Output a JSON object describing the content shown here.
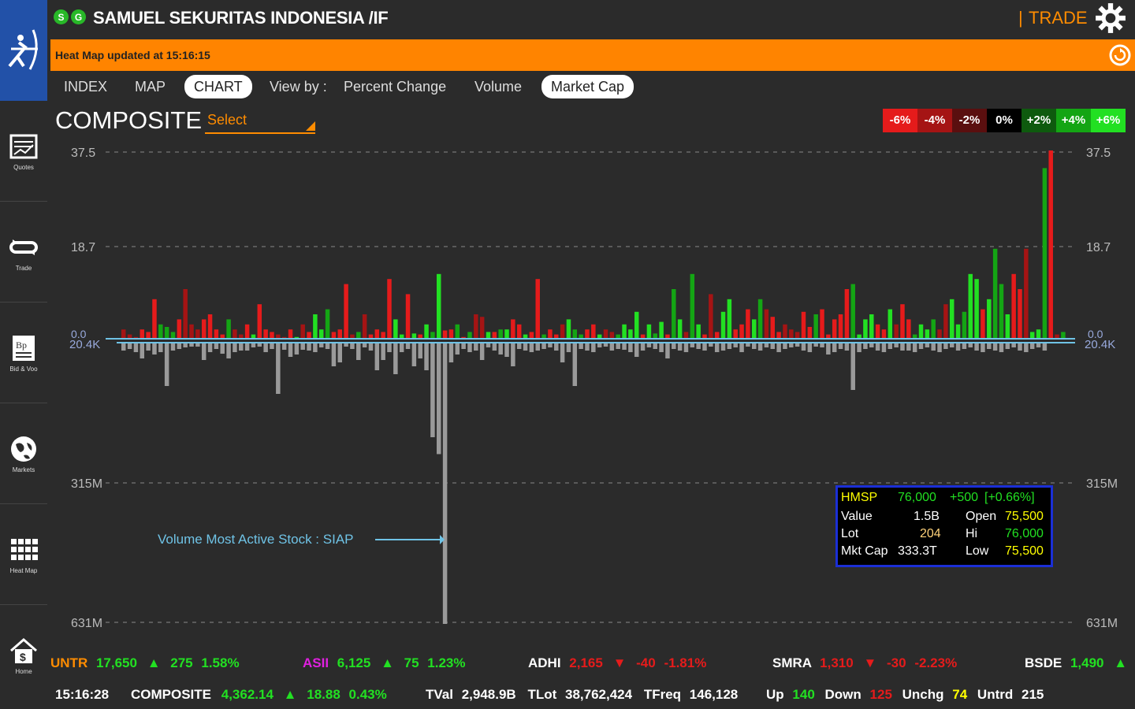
{
  "app": {
    "title": "SAMUEL SEKURITAS INDONESIA /IF",
    "badges": [
      "S",
      "G"
    ],
    "trade_sep": "|",
    "trade": "TRADE"
  },
  "heatmap_status": "Heat Map  updated at 15:16:15",
  "sidebar": {
    "items": [
      {
        "label": "Quotes",
        "icon": "quotes-icon"
      },
      {
        "label": "Trade",
        "icon": "trade-icon"
      },
      {
        "label": "Bid & Voo",
        "icon": "bid-offer-icon"
      },
      {
        "label": "Markets",
        "icon": "markets-icon"
      },
      {
        "label": "Heat Map",
        "icon": "heatmap-icon"
      },
      {
        "label": "Home",
        "icon": "home-icon"
      }
    ]
  },
  "nav": {
    "index": "INDEX",
    "map": "MAP",
    "chart": "CHART",
    "viewby": "View by :",
    "percent": "Percent Change",
    "volume": "Volume",
    "marketcap": "Market Cap"
  },
  "composite_title": "COMPOSITE",
  "select_label": "Select",
  "legend": [
    {
      "label": "-6%",
      "color": "#e51b1b"
    },
    {
      "label": "-4%",
      "color": "#a51414"
    },
    {
      "label": "-2%",
      "color": "#5a0f0f"
    },
    {
      "label": "0%",
      "color": "#000000"
    },
    {
      "label": "+2%",
      "color": "#0e5a0e"
    },
    {
      "label": "+4%",
      "color": "#14a514"
    },
    {
      "label": "+6%",
      "color": "#22e022"
    }
  ],
  "chart_data": {
    "type": "bar",
    "title": "COMPOSITE",
    "upper_axis": {
      "ticks": [
        "37.5",
        "18.7",
        "0.0"
      ],
      "range": [
        0,
        37.5
      ]
    },
    "lower_axis": {
      "ticks": [
        "20.4K",
        "315M",
        "631M"
      ],
      "range": [
        0,
        631
      ]
    },
    "annotation": "Volume Most Active Stock : SIAP",
    "series": [
      {
        "values_upper": [
          2,
          1,
          0.5,
          2,
          1.5,
          8,
          3,
          2.5,
          1.5,
          4,
          10,
          3,
          2,
          4,
          5,
          2,
          1,
          4,
          2,
          1,
          3,
          1,
          7,
          2,
          1.5,
          1,
          0.5,
          2,
          0.5,
          3,
          1.5,
          5,
          2,
          6,
          1.5,
          2,
          11,
          1,
          1.5,
          5,
          1,
          2,
          1.5,
          12,
          4,
          1,
          9,
          1.2,
          1,
          3,
          1.5,
          13,
          1.8,
          2,
          3,
          0.5,
          1.5,
          5,
          4.5,
          1.5,
          1.5,
          2,
          2,
          4,
          3,
          1,
          1.5,
          12,
          1,
          2,
          1,
          3,
          4,
          2,
          1,
          2,
          3,
          1,
          2,
          1.5,
          1,
          3,
          2,
          5.5,
          1,
          3,
          1.2,
          3.5,
          1,
          10,
          4,
          1.5,
          13,
          3,
          1,
          9,
          1.5,
          5.5,
          8,
          2,
          3,
          6,
          4,
          8,
          6,
          4.5,
          1.5,
          3,
          2,
          1.5,
          5.5,
          2.5,
          5,
          6,
          1,
          4,
          5,
          10,
          11,
          1,
          4,
          5,
          3,
          2,
          6,
          3,
          7,
          4,
          1,
          3,
          2,
          4,
          2,
          7,
          8,
          3,
          5.5,
          13,
          12,
          6,
          8,
          18,
          11,
          5,
          13,
          10,
          18,
          1.5,
          2,
          34,
          37.5,
          1,
          1.5
        ],
        "values_lower": [
          10,
          8,
          12,
          20,
          10,
          15,
          12,
          55,
          10,
          8,
          6,
          5,
          5,
          22,
          12,
          8,
          14,
          20,
          12,
          10,
          10,
          6,
          5,
          12,
          8,
          65,
          9,
          18,
          15,
          9,
          10,
          12,
          6,
          8,
          30,
          25,
          5,
          8,
          22,
          6,
          10,
          35,
          22,
          12,
          40,
          12,
          8,
          30,
          20,
          35,
          120,
          250,
          631,
          25,
          15,
          8,
          12,
          10,
          22,
          6,
          10,
          15,
          18,
          30,
          8,
          10,
          12,
          10,
          8,
          6,
          10,
          25,
          12,
          55,
          8,
          10,
          12,
          6,
          5,
          10,
          8,
          9,
          12,
          18,
          10,
          6,
          8,
          12,
          20,
          8,
          10,
          12,
          6,
          8,
          10,
          5,
          12,
          10,
          8,
          6,
          12,
          5,
          8,
          10,
          6,
          8,
          12,
          8,
          6,
          5,
          10,
          12,
          5,
          6,
          15,
          12,
          8,
          10,
          60,
          12,
          8,
          6,
          10,
          12,
          8,
          6,
          10,
          10,
          12,
          8,
          6,
          10,
          12,
          8,
          6,
          10,
          8,
          6,
          10,
          12,
          8,
          10,
          12,
          8,
          6,
          10,
          12,
          8,
          6,
          10
        ]
      }
    ]
  },
  "info": {
    "code": "HMSP",
    "price": "76,000",
    "chg": "+500",
    "pct": "[+0.66%]",
    "value_label": "Value",
    "value": "1.5B",
    "open_label": "Open",
    "open": "75,500",
    "lot_label": "Lot",
    "lot": "204",
    "hi_label": "Hi",
    "hi": "76,000",
    "mcap_label": "Mkt Cap",
    "mcap": "333.3T",
    "low_label": "Low",
    "low": "75,500"
  },
  "ticker": [
    {
      "code": "UNTR",
      "price": "17,650",
      "chg": "275",
      "pct": "1.58%",
      "dir": "up",
      "code_color": "#ff8c00"
    },
    {
      "code": "ASII",
      "price": "6,125",
      "chg": "75",
      "pct": "1.23%",
      "dir": "up",
      "code_color": "#e020e0"
    },
    {
      "code": "ADHI",
      "price": "2,165",
      "chg": "-40",
      "pct": "-1.81%",
      "dir": "down",
      "code_color": "#ffffff"
    },
    {
      "code": "SMRA",
      "price": "1,310",
      "chg": "-30",
      "pct": "-2.23%",
      "dir": "down",
      "code_color": "#ffffff"
    },
    {
      "code": "BSDE",
      "price": "1,490",
      "chg": "",
      "pct": "",
      "dir": "up",
      "code_color": "#ffffff"
    }
  ],
  "stats": {
    "time": "15:16:28",
    "composite_label": "COMPOSITE",
    "composite": "4,362.14",
    "composite_chg": "18.88",
    "composite_pct": "0.43%",
    "tval_label": "TVal",
    "tval": "2,948.9B",
    "tlot_label": "TLot",
    "tlot": "38,762,424",
    "tfreq_label": "TFreq",
    "tfreq": "146,128",
    "up_label": "Up",
    "up": "140",
    "down_label": "Down",
    "down": "125",
    "unchg_label": "Unchg",
    "unchg": "74",
    "untrd_label": "Untrd",
    "untrd": "215"
  }
}
